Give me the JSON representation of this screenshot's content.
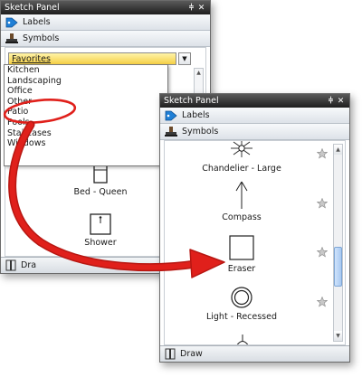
{
  "panel1": {
    "title": "Sketch Panel",
    "pin": "p",
    "close": "✕",
    "sections": {
      "labels": "Labels",
      "symbols": "Symbols"
    },
    "dropdown": {
      "selected": "Favorites",
      "options": [
        "Kitchen",
        "Landscaping",
        "Office",
        "Other",
        "Patio",
        "Pools",
        "Staircases",
        "Windows"
      ]
    },
    "symbols": [
      {
        "label": "Bed - Queen"
      },
      {
        "label": "Shower"
      }
    ],
    "bottom_label": "Dra"
  },
  "panel2": {
    "title": "Sketch Panel",
    "pin": "p",
    "close": "✕",
    "sections": {
      "labels": "Labels",
      "symbols": "Symbols"
    },
    "symbols": [
      {
        "label": "Chandelier - Large"
      },
      {
        "label": "Compass"
      },
      {
        "label": "Eraser"
      },
      {
        "label": "Light - Recessed"
      }
    ],
    "bottom_label": "Draw"
  },
  "colors": {
    "annotation": "#e0201b",
    "dropdown_highlight": "#f5cf45",
    "tag_icon": "#1f7fd6"
  },
  "icons": [
    "tag-icon",
    "stamp-icon",
    "book-icon",
    "star-icon",
    "scroll-up-icon",
    "scroll-down-icon",
    "dropdown-arrow-icon"
  ]
}
